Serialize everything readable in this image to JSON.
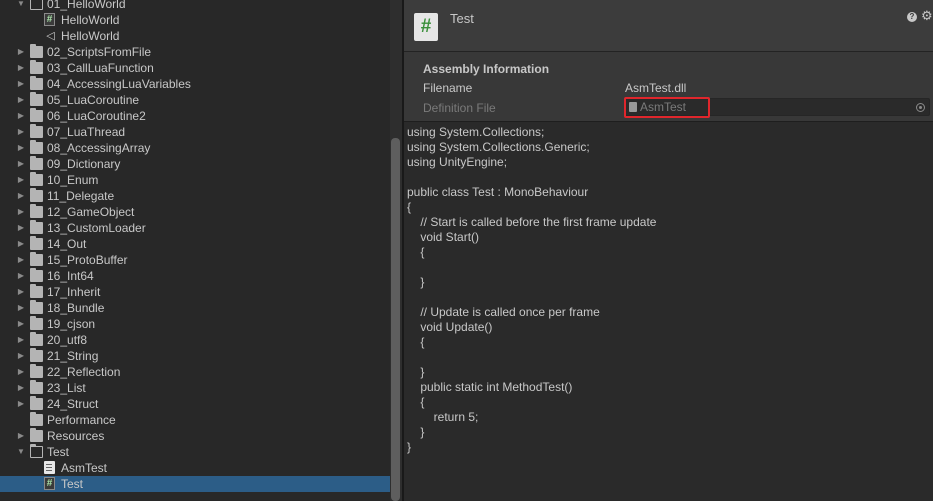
{
  "project_tree": {
    "items": [
      {
        "depth": 1,
        "kind": "folder-open",
        "expander": "expanded",
        "label": "01_HelloWorld"
      },
      {
        "depth": 2,
        "kind": "script",
        "expander": "none",
        "label": "HelloWorld"
      },
      {
        "depth": 2,
        "kind": "scene",
        "expander": "none",
        "label": "HelloWorld"
      },
      {
        "depth": 1,
        "kind": "folder",
        "expander": "collapsed",
        "label": "02_ScriptsFromFile"
      },
      {
        "depth": 1,
        "kind": "folder",
        "expander": "collapsed",
        "label": "03_CallLuaFunction"
      },
      {
        "depth": 1,
        "kind": "folder",
        "expander": "collapsed",
        "label": "04_AccessingLuaVariables"
      },
      {
        "depth": 1,
        "kind": "folder",
        "expander": "collapsed",
        "label": "05_LuaCoroutine"
      },
      {
        "depth": 1,
        "kind": "folder",
        "expander": "collapsed",
        "label": "06_LuaCoroutine2"
      },
      {
        "depth": 1,
        "kind": "folder",
        "expander": "collapsed",
        "label": "07_LuaThread"
      },
      {
        "depth": 1,
        "kind": "folder",
        "expander": "collapsed",
        "label": "08_AccessingArray"
      },
      {
        "depth": 1,
        "kind": "folder",
        "expander": "collapsed",
        "label": "09_Dictionary"
      },
      {
        "depth": 1,
        "kind": "folder",
        "expander": "collapsed",
        "label": "10_Enum"
      },
      {
        "depth": 1,
        "kind": "folder",
        "expander": "collapsed",
        "label": "11_Delegate"
      },
      {
        "depth": 1,
        "kind": "folder",
        "expander": "collapsed",
        "label": "12_GameObject"
      },
      {
        "depth": 1,
        "kind": "folder",
        "expander": "collapsed",
        "label": "13_CustomLoader"
      },
      {
        "depth": 1,
        "kind": "folder",
        "expander": "collapsed",
        "label": "14_Out"
      },
      {
        "depth": 1,
        "kind": "folder",
        "expander": "collapsed",
        "label": "15_ProtoBuffer"
      },
      {
        "depth": 1,
        "kind": "folder",
        "expander": "collapsed",
        "label": "16_Int64"
      },
      {
        "depth": 1,
        "kind": "folder",
        "expander": "collapsed",
        "label": "17_Inherit"
      },
      {
        "depth": 1,
        "kind": "folder",
        "expander": "collapsed",
        "label": "18_Bundle"
      },
      {
        "depth": 1,
        "kind": "folder",
        "expander": "collapsed",
        "label": "19_cjson"
      },
      {
        "depth": 1,
        "kind": "folder",
        "expander": "collapsed",
        "label": "20_utf8"
      },
      {
        "depth": 1,
        "kind": "folder",
        "expander": "collapsed",
        "label": "21_String"
      },
      {
        "depth": 1,
        "kind": "folder",
        "expander": "collapsed",
        "label": "22_Reflection"
      },
      {
        "depth": 1,
        "kind": "folder",
        "expander": "collapsed",
        "label": "23_List"
      },
      {
        "depth": 1,
        "kind": "folder",
        "expander": "collapsed",
        "label": "24_Struct"
      },
      {
        "depth": 1,
        "kind": "folder",
        "expander": "none",
        "label": "Performance"
      },
      {
        "depth": 1,
        "kind": "folder",
        "expander": "collapsed",
        "label": "Resources"
      },
      {
        "depth": 1,
        "kind": "folder-open",
        "expander": "expanded",
        "label": "Test"
      },
      {
        "depth": 2,
        "kind": "asmdef",
        "expander": "none",
        "label": "AsmTest"
      },
      {
        "depth": 2,
        "kind": "script",
        "expander": "none",
        "label": "Test",
        "selected": true
      }
    ]
  },
  "inspector": {
    "title": "Test",
    "icon": "csharp-script-icon",
    "assembly": {
      "heading": "Assembly Information",
      "filename_label": "Filename",
      "filename_value": "AsmTest.dll",
      "definition_label": "Definition File",
      "definition_value": "AsmTest"
    },
    "code": [
      "using System.Collections;",
      "using System.Collections.Generic;",
      "using UnityEngine;",
      "",
      "public class Test : MonoBehaviour",
      "{",
      "    // Start is called before the first frame update",
      "    void Start()",
      "    {",
      "",
      "    }",
      "",
      "    // Update is called once per frame",
      "    void Update()",
      "    {",
      "",
      "    }",
      "    public static int MethodTest()",
      "    {",
      "        return 5;",
      "    }",
      "}"
    ]
  },
  "colors": {
    "selection": "#2c5d87",
    "highlight_box": "#e0262c",
    "script_icon_glyph": "#3a8f3a"
  }
}
